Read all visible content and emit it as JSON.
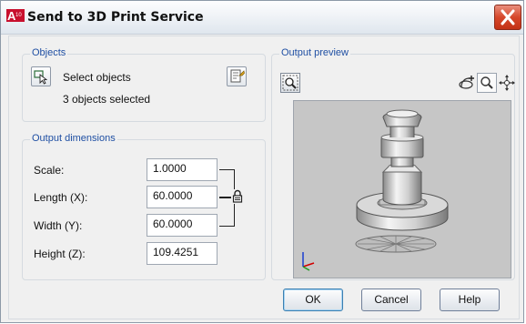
{
  "window": {
    "title": "Send to 3D Print Service",
    "icon_letter": "A",
    "icon_version": "10"
  },
  "objects": {
    "legend": "Objects",
    "select_label": "Select objects",
    "count_text": "3 objects selected",
    "select_icon": "select-cursor-icon",
    "filter_icon": "quick-select-icon"
  },
  "dimensions": {
    "legend": "Output dimensions",
    "scale_label": "Scale:",
    "scale_value": "1.0000",
    "length_label": "Length (X):",
    "length_value": "60.0000",
    "width_label": "Width (Y):",
    "width_value": "60.0000",
    "height_label": "Height (Z):",
    "height_value": "109.4251",
    "lock_icon": "lock-icon"
  },
  "preview": {
    "legend": "Output preview",
    "zoom_extents_icon": "zoom-extents-icon",
    "orbit_icon": "orbit-icon",
    "zoom_icon": "zoom-icon",
    "pan_icon": "pan-icon",
    "background_color": "#c6c6c6"
  },
  "buttons": {
    "ok": "OK",
    "cancel": "Cancel",
    "help": "Help"
  },
  "colors": {
    "legend_text": "#1f4fa3",
    "close_button": "#d6472b",
    "app_icon_red": "#c8102e"
  }
}
